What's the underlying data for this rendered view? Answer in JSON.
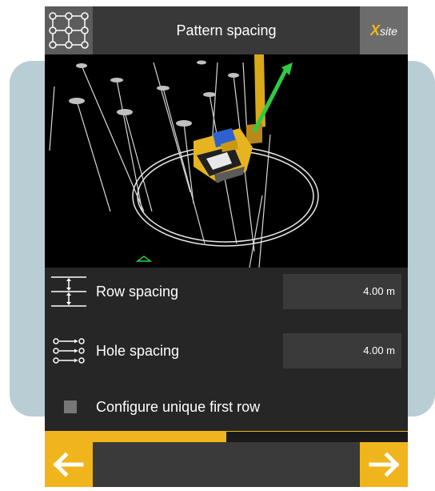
{
  "header": {
    "title": "Pattern spacing",
    "menu_icon": "grid-pattern-icon",
    "logo_x": "X",
    "logo_text": "site"
  },
  "viewport": {
    "description_icon": "excavator-3d-view"
  },
  "rows": [
    {
      "label": "Row spacing",
      "value": "4.00 m",
      "icon": "row-spacing-icon"
    },
    {
      "label": "Hole spacing",
      "value": "4.00 m",
      "icon": "hole-spacing-icon"
    }
  ],
  "unique_row": {
    "label": "Configure unique first row",
    "checked": false
  },
  "progress": {
    "fraction": 0.5
  },
  "footer": {
    "back_icon": "arrow-left-icon",
    "next_icon": "arrow-right-icon"
  },
  "colors": {
    "accent": "#f0b41c",
    "background": "#262626",
    "panel": "#b9cdd5"
  }
}
